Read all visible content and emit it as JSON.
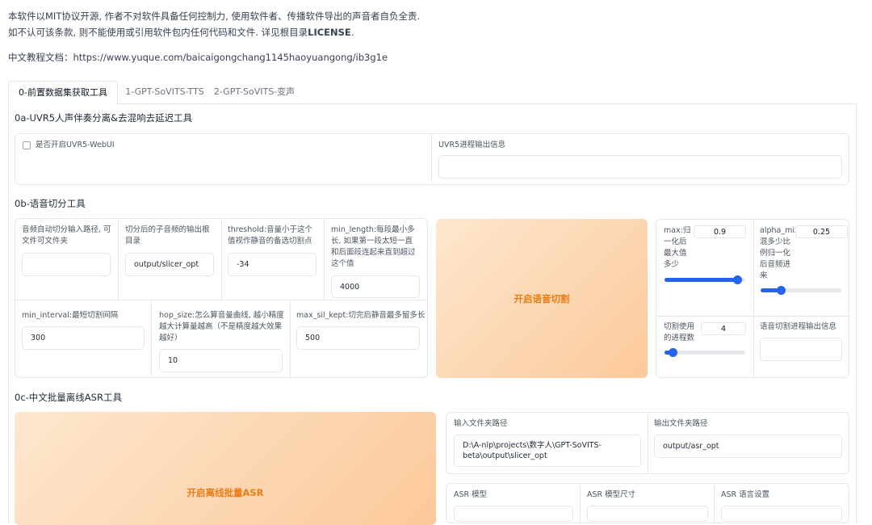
{
  "notice": {
    "line1": "本软件以MIT协议开源, 作者不对软件具备任何控制力, 使用软件者、传播软件导出的声音者自负全责.",
    "line2_prefix": "如不认可该条款, 则不能使用或引用软件包内任何代码和文件. 详见根目录",
    "line2_bold": "LICENSE",
    "line2_suffix": ".",
    "doc_label": "中文教程文档：",
    "doc_url": "https://www.yuque.com/baicaigongchang1145haoyuangong/ib3g1e"
  },
  "tabs": [
    "0-前置数据集获取工具",
    "1-GPT-SoVITS-TTS",
    "2-GPT-SoVITS-变声"
  ],
  "uvr": {
    "title": "0a-UVR5人声伴奏分离&去混响去延迟工具",
    "checkbox_label": "是否开启UVR5-WebUI",
    "checked": false,
    "output_label": "UVR5进程输出信息",
    "output_value": ""
  },
  "slicer": {
    "title": "0b-语音切分工具",
    "input_path_label": "音频自动切分输入路径, 可文件可文件夹",
    "input_path_value": "",
    "output_dir_label": "切分后的子音频的输出根目录",
    "output_dir_value": "output/slicer_opt",
    "threshold_label": "threshold:音量小于这个值视作静音的备选切割点",
    "threshold_value": "-34",
    "min_length_label": "min_length:每段最小多长, 如果第一段太短一直和后面段连起来直到超过这个值",
    "min_length_value": "4000",
    "min_interval_label": "min_interval:最短切割间隔",
    "min_interval_value": "300",
    "hop_size_label": "hop_size:怎么算音量曲线, 越小精度越大计算量越高（不是精度越大效果越好）",
    "hop_size_value": "10",
    "max_sil_label": "max_sil_kept:切完后静音最多留多长",
    "max_sil_value": "500",
    "start_button": "开启语音切割",
    "max_label": "max:归一化后最大值多少",
    "max_value": "0.9",
    "max_fraction": 0.9,
    "alpha_label": "alpha_mix:混多少比例归一化后音频进来",
    "alpha_value": "0.25",
    "alpha_fraction": 0.25,
    "procs_label": "切割使用的进程数",
    "procs_value": "4",
    "procs_fraction": 0.1,
    "output_label": "语音切割进程输出信息",
    "output_value": ""
  },
  "asr": {
    "title": "0c-中文批量离线ASR工具",
    "start_button": "开启离线批量ASR",
    "input_dir_label": "输入文件夹路径",
    "input_dir_value": "D:\\A-nlp\\projects\\数字人\\GPT-SoVITS-beta\\output\\slicer_opt",
    "output_dir_label": "输出文件夹路径",
    "output_dir_value": "output/asr_opt",
    "model_label": "ASR 模型",
    "model_size_label": "ASR 模型尺寸",
    "lang_label": "ASR 语言设置"
  },
  "colors": {
    "accent": "#2563eb",
    "button_text": "#ea7c12"
  }
}
